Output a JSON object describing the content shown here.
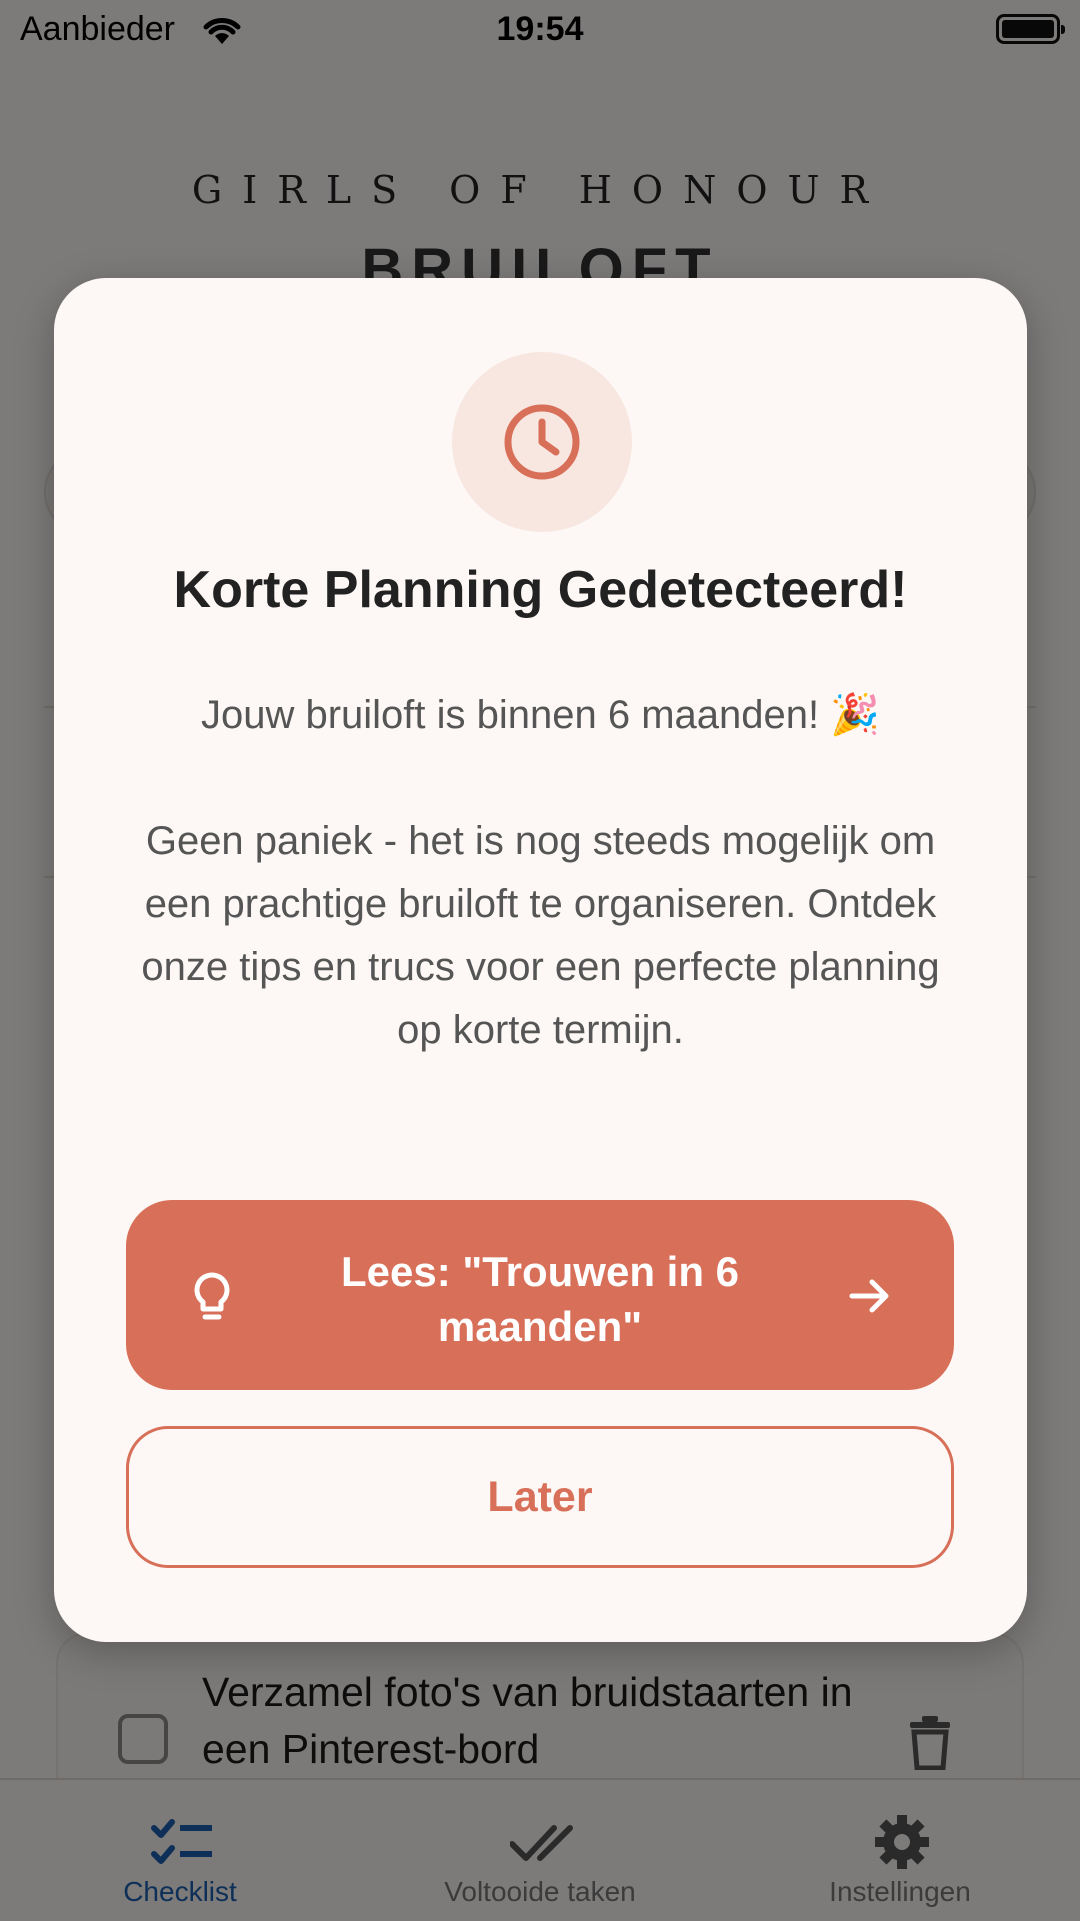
{
  "status_bar": {
    "carrier": "Aanbieder",
    "time": "19:54"
  },
  "header": {
    "brand_small": "GIRLS OF HONOUR",
    "brand_big": "BRUILOFT"
  },
  "task": {
    "text": "Verzamel foto's van bruidstaarten in een Pinterest-bord"
  },
  "tabs": [
    {
      "label": "Checklist",
      "icon": "checklist-icon",
      "active": true
    },
    {
      "label": "Voltooide taken",
      "icon": "double-check-icon",
      "active": false
    },
    {
      "label": "Instellingen",
      "icon": "gear-icon",
      "active": false
    }
  ],
  "modal": {
    "icon": "clock-icon",
    "title": "Korte Planning Gedetecteerd!",
    "message_line1": "Jouw bruiloft is binnen 6 maanden! 🎉",
    "message_line2": "Geen paniek - het is nog steeds mogelijk om een prachtige bruiloft te organiseren. Ontdek onze tips en trucs voor een perfecte planning op korte termijn.",
    "primary_button": "Lees: \"Trouwen in 6 maanden\"",
    "secondary_button": "Later"
  },
  "colors": {
    "accent": "#d86f58",
    "tab_active": "#1d5fae",
    "modal_background": "#fdf8f5"
  }
}
